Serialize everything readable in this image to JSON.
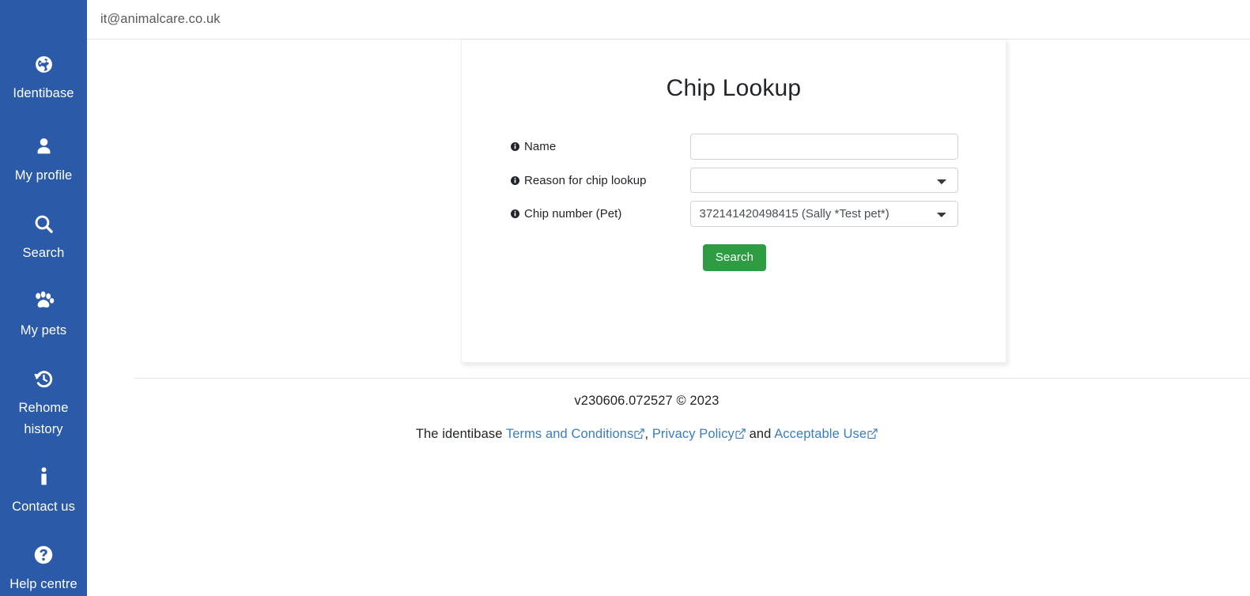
{
  "sidebar": {
    "background_color": "#2b5aa8",
    "items": [
      {
        "label": "Identibase",
        "icon": "globe-icon"
      },
      {
        "label": "My profile",
        "icon": "user-icon"
      },
      {
        "label": "Search",
        "icon": "magnifier-icon"
      },
      {
        "label": "My pets",
        "icon": "paw-icon"
      },
      {
        "label": "Rehome\nhistory",
        "icon": "clock-rotate-left-icon"
      },
      {
        "label": "Contact us",
        "icon": "info-icon"
      },
      {
        "label": "Help centre",
        "icon": "question-circle-icon"
      }
    ]
  },
  "header": {
    "email": "it@animalcare.co.uk"
  },
  "card": {
    "title": "Chip Lookup",
    "fields": [
      {
        "label": "Name",
        "info_icon": "info-circle-icon",
        "type": "text",
        "value": "",
        "placeholder": ""
      },
      {
        "label": "Reason for chip lookup",
        "info_icon": "info-circle-icon",
        "type": "select",
        "value": "",
        "options": [
          ""
        ]
      },
      {
        "label": "Chip number (Pet)",
        "info_icon": "info-circle-icon",
        "type": "select",
        "value": "372141420498415 (Sally *Test pet*)",
        "options": [
          "372141420498415 (Sally *Test pet*)"
        ]
      }
    ],
    "submit_label": "Search",
    "submit_color": "#2e9c43"
  },
  "footer": {
    "version": "v230606.072527 © 2023",
    "legal_prefix": "The identibase ",
    "links": [
      {
        "label": "Terms and Conditions",
        "icon": "external-link-icon"
      },
      {
        "label": "Privacy Policy",
        "icon": "external-link-icon"
      },
      {
        "label": "Acceptable Use",
        "icon": "external-link-icon"
      }
    ],
    "separator_1": ", ",
    "separator_2": " and ",
    "link_color": "#3b7dbf"
  }
}
